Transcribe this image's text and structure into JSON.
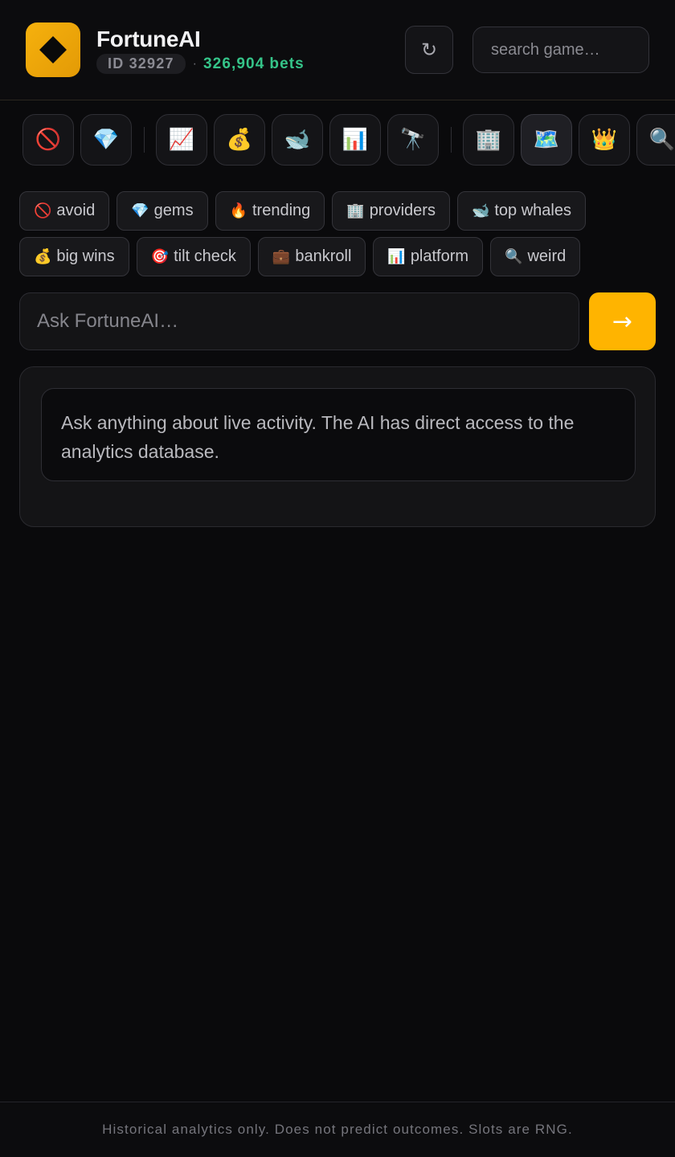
{
  "header": {
    "title": "FortuneAI",
    "id_badge": "ID 32927",
    "separator": "·",
    "bets_count": "326,904",
    "bets_suffix": "bets",
    "refresh_icon": "↻",
    "search_placeholder": "search game…"
  },
  "toolbar": {
    "icons": [
      {
        "name": "avoid",
        "glyph": "🚫"
      },
      {
        "name": "gems",
        "glyph": "💎"
      },
      {
        "name": "trending-chart",
        "glyph": "📈"
      },
      {
        "name": "money-bag",
        "glyph": "💰"
      },
      {
        "name": "whale",
        "glyph": "🐋"
      },
      {
        "name": "bar-chart",
        "glyph": "📊"
      },
      {
        "name": "telescope",
        "glyph": "🔭"
      },
      {
        "name": "office-building",
        "glyph": "🏢"
      },
      {
        "name": "map",
        "glyph": "🗺️"
      },
      {
        "name": "crown",
        "glyph": "👑"
      },
      {
        "name": "magnifier",
        "glyph": "🔍"
      }
    ]
  },
  "chips": {
    "row1": [
      {
        "icon": "🚫",
        "label": "avoid"
      },
      {
        "icon": "💎",
        "label": "gems"
      },
      {
        "icon": "🔥",
        "label": "trending"
      },
      {
        "icon": "🏢",
        "label": "providers"
      },
      {
        "icon": "🐋",
        "label": "top whales"
      }
    ],
    "row2": [
      {
        "icon": "💰",
        "label": "big wins"
      },
      {
        "icon": "🎯",
        "label": "tilt check"
      },
      {
        "icon": "💼",
        "label": "bankroll"
      },
      {
        "icon": "📊",
        "label": "platform"
      },
      {
        "icon": "🔍",
        "label": "weird"
      }
    ]
  },
  "ask": {
    "placeholder": "Ask FortuneAI…",
    "send_icon": "→"
  },
  "response": {
    "message": "Ask anything about live activity. The AI has direct access to the analytics database."
  },
  "footer": {
    "disclaimer": "Historical analytics only. Does not predict outcomes. Slots are RNG."
  },
  "colors": {
    "accent": "#ffb400",
    "positive": "#35c489",
    "background": "#0a0a0c"
  }
}
